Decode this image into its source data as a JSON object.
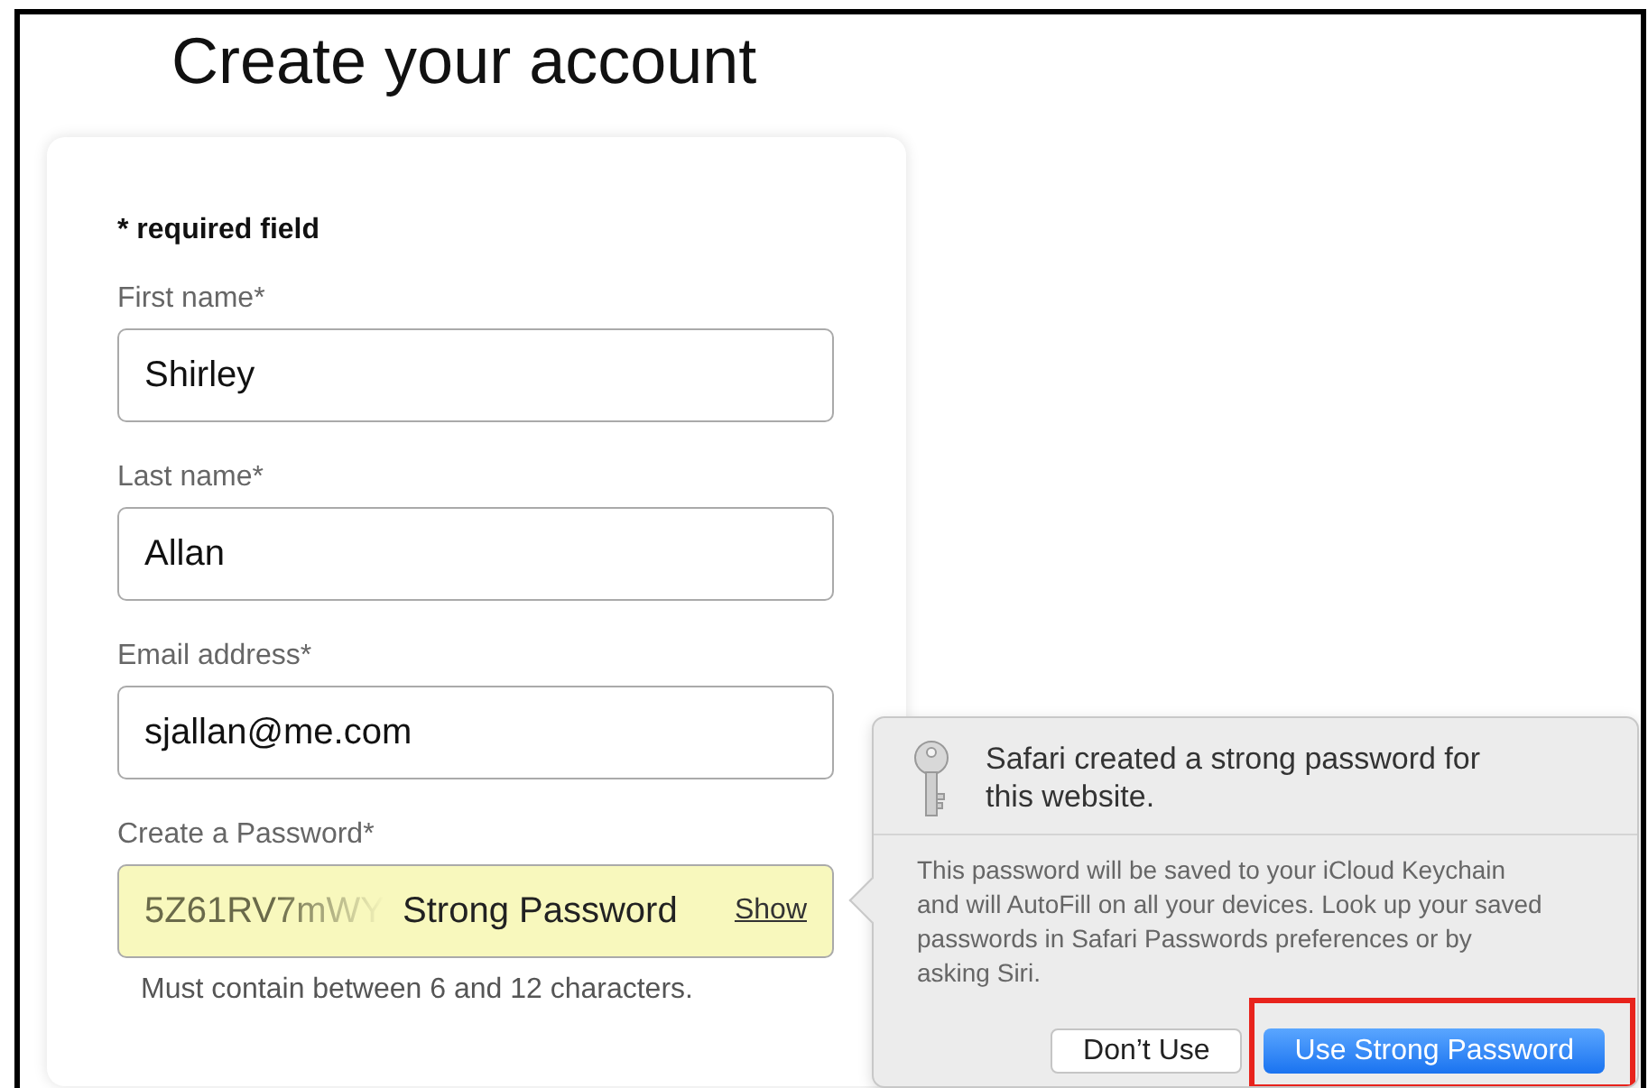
{
  "page": {
    "title": "Create your account"
  },
  "form": {
    "required_note": "* required field",
    "fields": [
      {
        "kind": "text",
        "label": "First name*",
        "value": "Shirley"
      },
      {
        "kind": "text",
        "label": "Last name*",
        "value": "Allan"
      },
      {
        "kind": "text",
        "label": "Email address*",
        "value": "sjallan@me.com"
      },
      {
        "kind": "password",
        "label": "Create a Password*",
        "value": "5Z61RV7mWY",
        "autofilled": true,
        "badge": "Strong Password",
        "toggle": "Show",
        "hint": "Must contain between 6 and 12 characters."
      }
    ]
  },
  "popover": {
    "title": "Safari created a strong password for this website.",
    "message": "This password will be saved to your iCloud Keychain and will AutoFill on all your devices. Look up your saved passwords in Safari Passwords preferences or by asking Siri.",
    "buttons": [
      {
        "kind": "secondary",
        "label": "Don’t Use",
        "highlighted": false
      },
      {
        "kind": "primary",
        "label": "Use Strong Password",
        "highlighted": true
      }
    ]
  }
}
